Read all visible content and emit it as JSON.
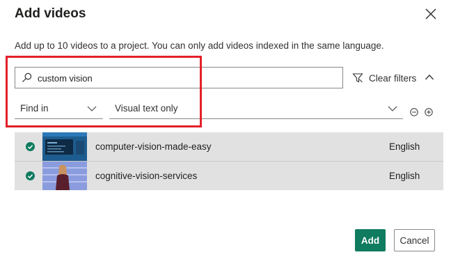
{
  "dialog": {
    "title": "Add videos",
    "description": "Add up to 10 videos to a project. You can only add videos indexed in the same language."
  },
  "search": {
    "value": "custom vision",
    "icon": "search-icon"
  },
  "filters": {
    "clear_label": "Clear filters",
    "find_in": {
      "selected": "Find in"
    },
    "visual_text": {
      "selected": "Visual text only"
    }
  },
  "videos": [
    {
      "name": "computer-vision-made-easy",
      "language": "English",
      "selected": true
    },
    {
      "name": "cognitive-vision-services",
      "language": "English",
      "selected": true
    }
  ],
  "actions": {
    "add_label": "Add",
    "cancel_label": "Cancel"
  },
  "colors": {
    "primary": "#0f7b5f",
    "highlight": "#e3202a",
    "row_bg": "#e1e1e1"
  }
}
